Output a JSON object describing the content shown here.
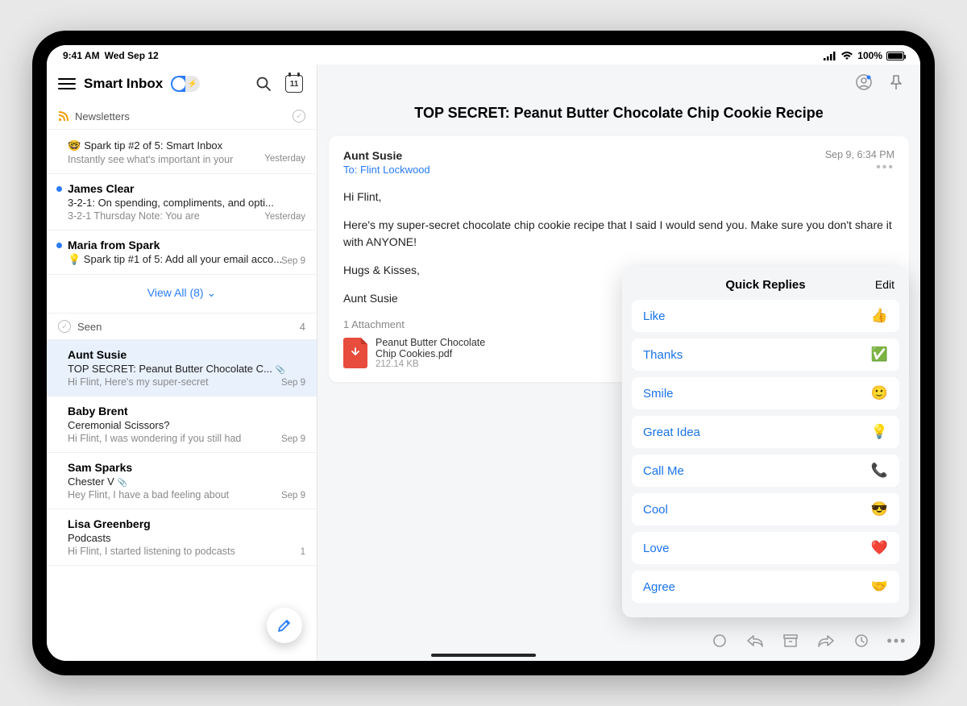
{
  "status": {
    "time": "9:41 AM",
    "date": "Wed Sep 12",
    "battery": "100%"
  },
  "sidebar": {
    "title": "Smart Inbox",
    "calendar_day": "11",
    "sections": {
      "newsletters": {
        "label": "Newsletters"
      },
      "seen": {
        "label": "Seen",
        "count": "4"
      }
    },
    "view_all": "View All (8)",
    "newsletters_items": [
      {
        "emoji": "🤓",
        "subject": "Spark tip #2 of 5: Smart Inbox",
        "preview": "Instantly see what's important in your",
        "date": "Yesterday"
      },
      {
        "unread": true,
        "sender": "James Clear",
        "subject": "3-2-1: On spending, compliments, and opti...",
        "preview": "3-2-1 Thursday Note: You are",
        "date": "Yesterday"
      },
      {
        "unread": true,
        "sender": "Maria from Spark",
        "subject": "💡 Spark tip #1 of 5: Add all your email acco...",
        "date": "Sep 9"
      }
    ],
    "seen_items": [
      {
        "selected": true,
        "sender": "Aunt Susie",
        "subject": "TOP SECRET: Peanut Butter Chocolate C...",
        "preview": "Hi Flint, Here's my super-secret",
        "date": "Sep 9",
        "has_attachment": true
      },
      {
        "sender": "Baby Brent",
        "subject": "Ceremonial Scissors?",
        "preview": "Hi Flint, I was wondering if you still had",
        "date": "Sep 9"
      },
      {
        "sender": "Sam Sparks",
        "subject": "Chester V",
        "preview": "Hey Flint, I have a bad feeling about",
        "date": "Sep 9",
        "has_attachment": true
      },
      {
        "sender": "Lisa Greenberg",
        "subject": "Podcasts",
        "preview": "Hi Flint, I started listening to podcasts",
        "date": "1"
      }
    ]
  },
  "message": {
    "subject": "TOP SECRET: Peanut Butter Chocolate Chip Cookie Recipe",
    "from": "Aunt Susie",
    "to_label": "To: Flint Lockwood",
    "date": "Sep 9, 6:34 PM",
    "body": {
      "greeting": "Hi Flint,",
      "p1": "Here's my super-secret chocolate chip cookie recipe that I said I would send you. Make sure you don't share it with ANYONE!",
      "p2": "Hugs & Kisses,",
      "signoff": "Aunt Susie"
    },
    "attachments": {
      "label": "1 Attachment",
      "file": {
        "name": "Peanut Butter Chocolate Chip Cookies.pdf",
        "size": "212.14 KB"
      }
    }
  },
  "quick_replies": {
    "title": "Quick Replies",
    "edit": "Edit",
    "items": [
      {
        "label": "Like",
        "emoji": "👍"
      },
      {
        "label": "Thanks",
        "emoji": "✅"
      },
      {
        "label": "Smile",
        "emoji": "🙂"
      },
      {
        "label": "Great Idea",
        "emoji": "💡"
      },
      {
        "label": "Call Me",
        "emoji": "📞"
      },
      {
        "label": "Cool",
        "emoji": "😎"
      },
      {
        "label": "Love",
        "emoji": "❤️"
      },
      {
        "label": "Agree",
        "emoji": "🤝"
      }
    ]
  }
}
